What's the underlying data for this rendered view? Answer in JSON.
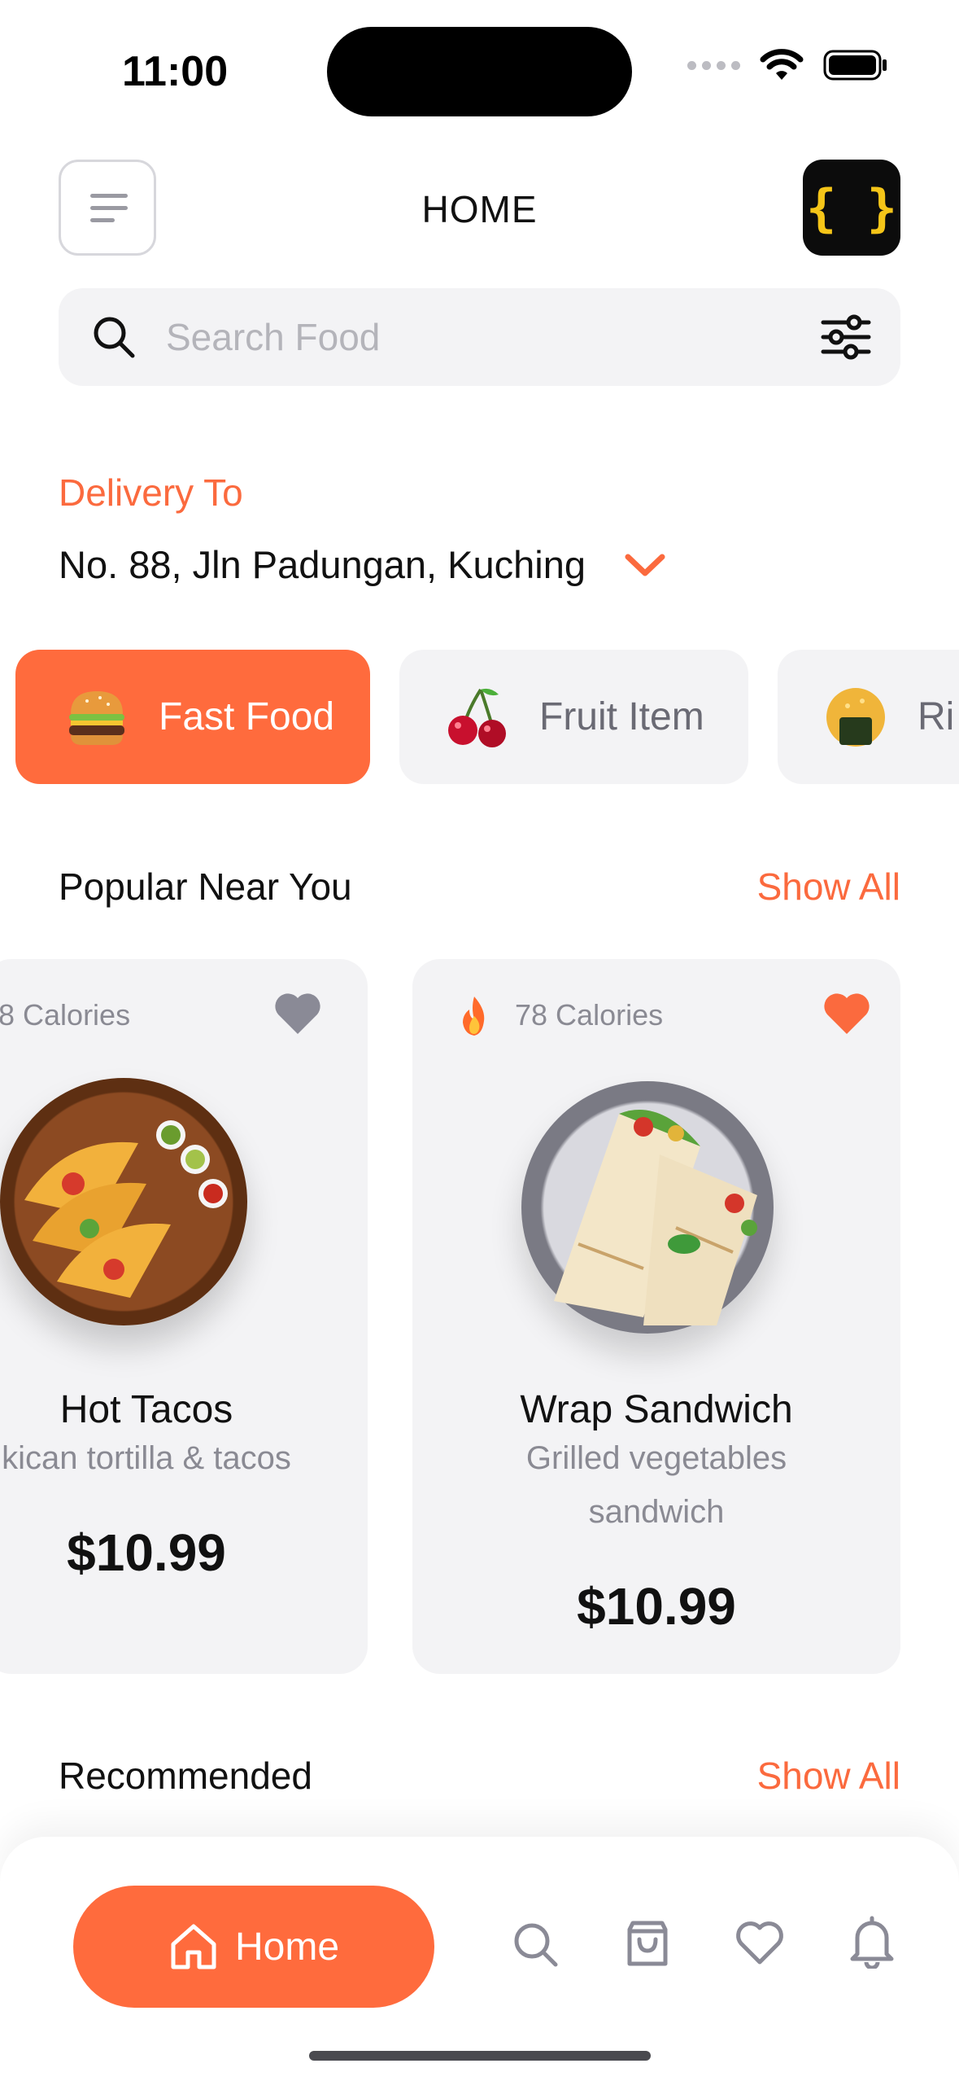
{
  "status_bar": {
    "time": "11:00"
  },
  "header": {
    "title": "HOME",
    "logo_text": "{ }"
  },
  "search": {
    "placeholder": "Search Food"
  },
  "delivery": {
    "label": "Delivery To",
    "address": "No. 88, Jln Padungan, Kuching"
  },
  "categories": [
    {
      "label": "Fast Food",
      "icon": "burger-icon",
      "active": true
    },
    {
      "label": "Fruit Item",
      "icon": "cherry-icon",
      "active": false
    },
    {
      "label": "Ri",
      "icon": "rice-ball-icon",
      "active": false
    }
  ],
  "popular": {
    "title": "Popular Near You",
    "show_all": "Show All",
    "items": [
      {
        "calories": "8 Calories",
        "name": "Hot Tacos",
        "description": "kican tortilla & tacos",
        "price": "$10.99",
        "favorite": false
      },
      {
        "calories": "78 Calories",
        "name": "Wrap Sandwich",
        "description_line1": "Grilled vegetables",
        "description_line2": "sandwich",
        "price": "$10.99",
        "favorite": true
      }
    ]
  },
  "recommended": {
    "title": "Recommended",
    "show_all": "Show All"
  },
  "bottom_nav": {
    "home_label": "Home",
    "items": [
      "home-icon",
      "search-icon",
      "bag-icon",
      "heart-icon",
      "bell-icon"
    ]
  },
  "colors": {
    "accent": "#FF6B3D",
    "surface": "#F3F3F5",
    "muted": "#8A8A93",
    "favorite_inactive": "#8A8A96"
  }
}
